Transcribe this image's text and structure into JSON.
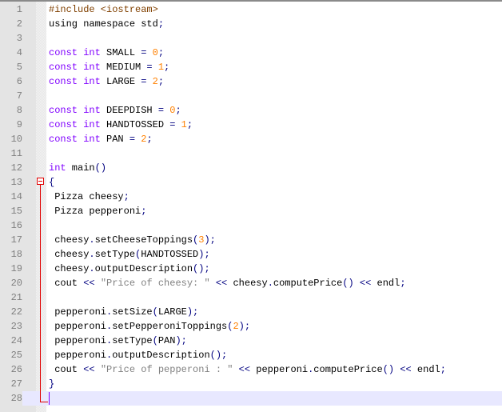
{
  "editor": {
    "language": "C++",
    "current_line": 28,
    "colors": {
      "keyword": "#8000ff",
      "number": "#ff8000",
      "operator": "#000080",
      "string": "#808080",
      "preprocessor": "#804000",
      "fold_marker": "#e00000",
      "current_line_bg": "#e8e8ff"
    },
    "lines": [
      {
        "n": "1",
        "tokens": [
          {
            "t": "pre",
            "v": "#include <iostream>"
          }
        ]
      },
      {
        "n": "2",
        "tokens": [
          {
            "t": "id",
            "v": "using namespace std"
          },
          {
            "t": "op",
            "v": ";"
          }
        ]
      },
      {
        "n": "3",
        "tokens": []
      },
      {
        "n": "4",
        "tokens": [
          {
            "t": "kw",
            "v": "const int"
          },
          {
            "t": "id",
            "v": " SMALL "
          },
          {
            "t": "op",
            "v": "="
          },
          {
            "t": "id",
            "v": " "
          },
          {
            "t": "num",
            "v": "0"
          },
          {
            "t": "op",
            "v": ";"
          }
        ]
      },
      {
        "n": "5",
        "tokens": [
          {
            "t": "kw",
            "v": "const int"
          },
          {
            "t": "id",
            "v": " MEDIUM "
          },
          {
            "t": "op",
            "v": "="
          },
          {
            "t": "id",
            "v": " "
          },
          {
            "t": "num",
            "v": "1"
          },
          {
            "t": "op",
            "v": ";"
          }
        ]
      },
      {
        "n": "6",
        "tokens": [
          {
            "t": "kw",
            "v": "const int"
          },
          {
            "t": "id",
            "v": " LARGE "
          },
          {
            "t": "op",
            "v": "="
          },
          {
            "t": "id",
            "v": " "
          },
          {
            "t": "num",
            "v": "2"
          },
          {
            "t": "op",
            "v": ";"
          }
        ]
      },
      {
        "n": "7",
        "tokens": []
      },
      {
        "n": "8",
        "tokens": [
          {
            "t": "kw",
            "v": "const int"
          },
          {
            "t": "id",
            "v": " DEEPDISH "
          },
          {
            "t": "op",
            "v": "="
          },
          {
            "t": "id",
            "v": " "
          },
          {
            "t": "num",
            "v": "0"
          },
          {
            "t": "op",
            "v": ";"
          }
        ]
      },
      {
        "n": "9",
        "tokens": [
          {
            "t": "kw",
            "v": "const int"
          },
          {
            "t": "id",
            "v": " HANDTOSSED "
          },
          {
            "t": "op",
            "v": "="
          },
          {
            "t": "id",
            "v": " "
          },
          {
            "t": "num",
            "v": "1"
          },
          {
            "t": "op",
            "v": ";"
          }
        ]
      },
      {
        "n": "10",
        "tokens": [
          {
            "t": "kw",
            "v": "const int"
          },
          {
            "t": "id",
            "v": " PAN "
          },
          {
            "t": "op",
            "v": "="
          },
          {
            "t": "id",
            "v": " "
          },
          {
            "t": "num",
            "v": "2"
          },
          {
            "t": "op",
            "v": ";"
          }
        ]
      },
      {
        "n": "11",
        "tokens": []
      },
      {
        "n": "12",
        "tokens": [
          {
            "t": "kw",
            "v": "int"
          },
          {
            "t": "id",
            "v": " main"
          },
          {
            "t": "op",
            "v": "()"
          }
        ]
      },
      {
        "n": "13",
        "tokens": [
          {
            "t": "op",
            "v": "{"
          }
        ]
      },
      {
        "n": "14",
        "tokens": [
          {
            "t": "id",
            "v": " Pizza cheesy"
          },
          {
            "t": "op",
            "v": ";"
          }
        ]
      },
      {
        "n": "15",
        "tokens": [
          {
            "t": "id",
            "v": " Pizza pepperoni"
          },
          {
            "t": "op",
            "v": ";"
          }
        ]
      },
      {
        "n": "16",
        "tokens": []
      },
      {
        "n": "17",
        "tokens": [
          {
            "t": "id",
            "v": " cheesy"
          },
          {
            "t": "op",
            "v": "."
          },
          {
            "t": "id",
            "v": "setCheeseToppings"
          },
          {
            "t": "op",
            "v": "("
          },
          {
            "t": "num",
            "v": "3"
          },
          {
            "t": "op",
            "v": ");"
          }
        ]
      },
      {
        "n": "18",
        "tokens": [
          {
            "t": "id",
            "v": " cheesy"
          },
          {
            "t": "op",
            "v": "."
          },
          {
            "t": "id",
            "v": "setType"
          },
          {
            "t": "op",
            "v": "("
          },
          {
            "t": "id",
            "v": "HANDTOSSED"
          },
          {
            "t": "op",
            "v": ");"
          }
        ]
      },
      {
        "n": "19",
        "tokens": [
          {
            "t": "id",
            "v": " cheesy"
          },
          {
            "t": "op",
            "v": "."
          },
          {
            "t": "id",
            "v": "outputDescription"
          },
          {
            "t": "op",
            "v": "();"
          }
        ]
      },
      {
        "n": "20",
        "tokens": [
          {
            "t": "id",
            "v": " cout "
          },
          {
            "t": "op",
            "v": "<<"
          },
          {
            "t": "id",
            "v": " "
          },
          {
            "t": "str",
            "v": "\"Price of cheesy: \""
          },
          {
            "t": "id",
            "v": " "
          },
          {
            "t": "op",
            "v": "<<"
          },
          {
            "t": "id",
            "v": " cheesy"
          },
          {
            "t": "op",
            "v": "."
          },
          {
            "t": "id",
            "v": "computePrice"
          },
          {
            "t": "op",
            "v": "()"
          },
          {
            "t": "id",
            "v": " "
          },
          {
            "t": "op",
            "v": "<<"
          },
          {
            "t": "id",
            "v": " endl"
          },
          {
            "t": "op",
            "v": ";"
          }
        ]
      },
      {
        "n": "21",
        "tokens": []
      },
      {
        "n": "22",
        "tokens": [
          {
            "t": "id",
            "v": " pepperoni"
          },
          {
            "t": "op",
            "v": "."
          },
          {
            "t": "id",
            "v": "setSize"
          },
          {
            "t": "op",
            "v": "("
          },
          {
            "t": "id",
            "v": "LARGE"
          },
          {
            "t": "op",
            "v": ");"
          }
        ]
      },
      {
        "n": "23",
        "tokens": [
          {
            "t": "id",
            "v": " pepperoni"
          },
          {
            "t": "op",
            "v": "."
          },
          {
            "t": "id",
            "v": "setPepperoniToppings"
          },
          {
            "t": "op",
            "v": "("
          },
          {
            "t": "num",
            "v": "2"
          },
          {
            "t": "op",
            "v": ");"
          }
        ]
      },
      {
        "n": "24",
        "tokens": [
          {
            "t": "id",
            "v": " pepperoni"
          },
          {
            "t": "op",
            "v": "."
          },
          {
            "t": "id",
            "v": "setType"
          },
          {
            "t": "op",
            "v": "("
          },
          {
            "t": "id",
            "v": "PAN"
          },
          {
            "t": "op",
            "v": ");"
          }
        ]
      },
      {
        "n": "25",
        "tokens": [
          {
            "t": "id",
            "v": " pepperoni"
          },
          {
            "t": "op",
            "v": "."
          },
          {
            "t": "id",
            "v": "outputDescription"
          },
          {
            "t": "op",
            "v": "();"
          }
        ]
      },
      {
        "n": "26",
        "tokens": [
          {
            "t": "id",
            "v": " cout "
          },
          {
            "t": "op",
            "v": "<<"
          },
          {
            "t": "id",
            "v": " "
          },
          {
            "t": "str",
            "v": "\"Price of pepperoni : \""
          },
          {
            "t": "id",
            "v": " "
          },
          {
            "t": "op",
            "v": "<<"
          },
          {
            "t": "id",
            "v": " pepperoni"
          },
          {
            "t": "op",
            "v": "."
          },
          {
            "t": "id",
            "v": "computePrice"
          },
          {
            "t": "op",
            "v": "()"
          },
          {
            "t": "id",
            "v": " "
          },
          {
            "t": "op",
            "v": "<<"
          },
          {
            "t": "id",
            "v": " endl"
          },
          {
            "t": "op",
            "v": ";"
          }
        ]
      },
      {
        "n": "27",
        "tokens": [
          {
            "t": "op",
            "v": "}"
          }
        ]
      },
      {
        "n": "28",
        "tokens": []
      }
    ]
  }
}
